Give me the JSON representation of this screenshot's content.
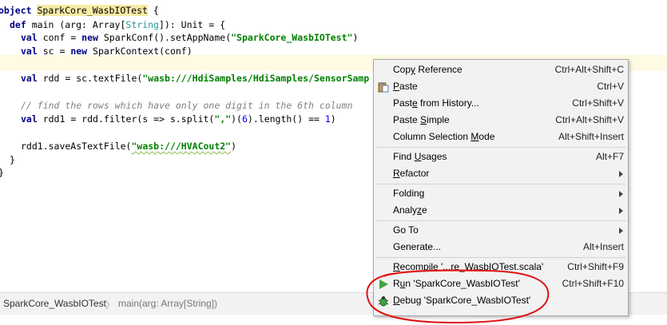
{
  "editor": {
    "lines": [
      {
        "kw": "object",
        "name": "SparkCore_WasbIOTest",
        "rest": " {"
      },
      {
        "kw": "def",
        "text1": " main (arg: Array[",
        "type": "String",
        "text2": "]): Unit = {"
      },
      {
        "kw": "val",
        "text1": " conf = ",
        "kw2": "new",
        "text2": " SparkConf().setAppName(",
        "str": "\"SparkCore_WasbIOTest\"",
        "text3": ")"
      },
      {
        "kw": "val",
        "text1": " sc = ",
        "kw2": "new",
        "text2": " SparkContext(conf)"
      },
      {
        "kw": "val",
        "text1": " rdd = sc.textFile(",
        "str": "\"wasb:///HdiSamples/HdiSamples/SensorSamp"
      },
      {
        "comment": "// find the rows which have only one digit in the 6th column"
      },
      {
        "kw": "val",
        "text1": " rdd1 = rdd.filter(s => s.split(",
        "str": "\",\"",
        "text2": ")(",
        "num1": "6",
        "text3": ").length() == ",
        "num2": "1",
        "text4": ")"
      },
      {
        "text1": "rdd1.saveAsTextFile(",
        "str": "\"wasb:///HVACout2\"",
        "text2": ")"
      },
      {
        "text1": "}"
      },
      {
        "text1": "}"
      }
    ]
  },
  "breadcrumb": {
    "object": "SparkCore_WasbIOTest",
    "method": "main(arg: Array[String])"
  },
  "context_menu": {
    "items": [
      {
        "pre": "Cop",
        "mn": "y",
        "post": " Reference",
        "shortcut": "Ctrl+Alt+Shift+C"
      },
      {
        "pre": "",
        "mn": "P",
        "post": "aste",
        "shortcut": "Ctrl+V",
        "icon": "paste-icon"
      },
      {
        "pre": "Past",
        "mn": "e",
        "post": " from History...",
        "shortcut": "Ctrl+Shift+V"
      },
      {
        "pre": "Paste ",
        "mn": "S",
        "post": "imple",
        "shortcut": "Ctrl+Alt+Shift+V"
      },
      {
        "pre": "Column Selection ",
        "mn": "M",
        "post": "ode",
        "shortcut": "Alt+Shift+Insert"
      },
      {
        "pre": "Find ",
        "mn": "U",
        "post": "sages",
        "shortcut": "Alt+F7"
      },
      {
        "pre": "",
        "mn": "R",
        "post": "efactor",
        "submenu": true
      },
      {
        "pre": "Folding",
        "mn": "",
        "post": "",
        "submenu": true
      },
      {
        "pre": "Analy",
        "mn": "z",
        "post": "e",
        "submenu": true
      },
      {
        "pre": "Go To",
        "mn": "",
        "post": "",
        "submenu": true
      },
      {
        "pre": "Generate...",
        "mn": "",
        "post": "",
        "shortcut": "Alt+Insert"
      },
      {
        "pre": "",
        "mn": "R",
        "post": "ecompile '...re_WasbIOTest.scala'",
        "shortcut": "Ctrl+Shift+F9"
      },
      {
        "pre": "R",
        "mn": "u",
        "post": "n 'SparkCore_WasbIOTest'",
        "shortcut": "Ctrl+Shift+F10",
        "icon": "run-icon"
      },
      {
        "pre": "",
        "mn": "D",
        "post": "ebug 'SparkCore_WasbIOTest'",
        "icon": "debug-icon"
      }
    ]
  },
  "colors": {
    "keyword": "#000080",
    "string": "#008000",
    "comment": "#808080",
    "number": "#0000ff",
    "run_green": "#3fa33f",
    "annotation_red": "#e01010"
  }
}
